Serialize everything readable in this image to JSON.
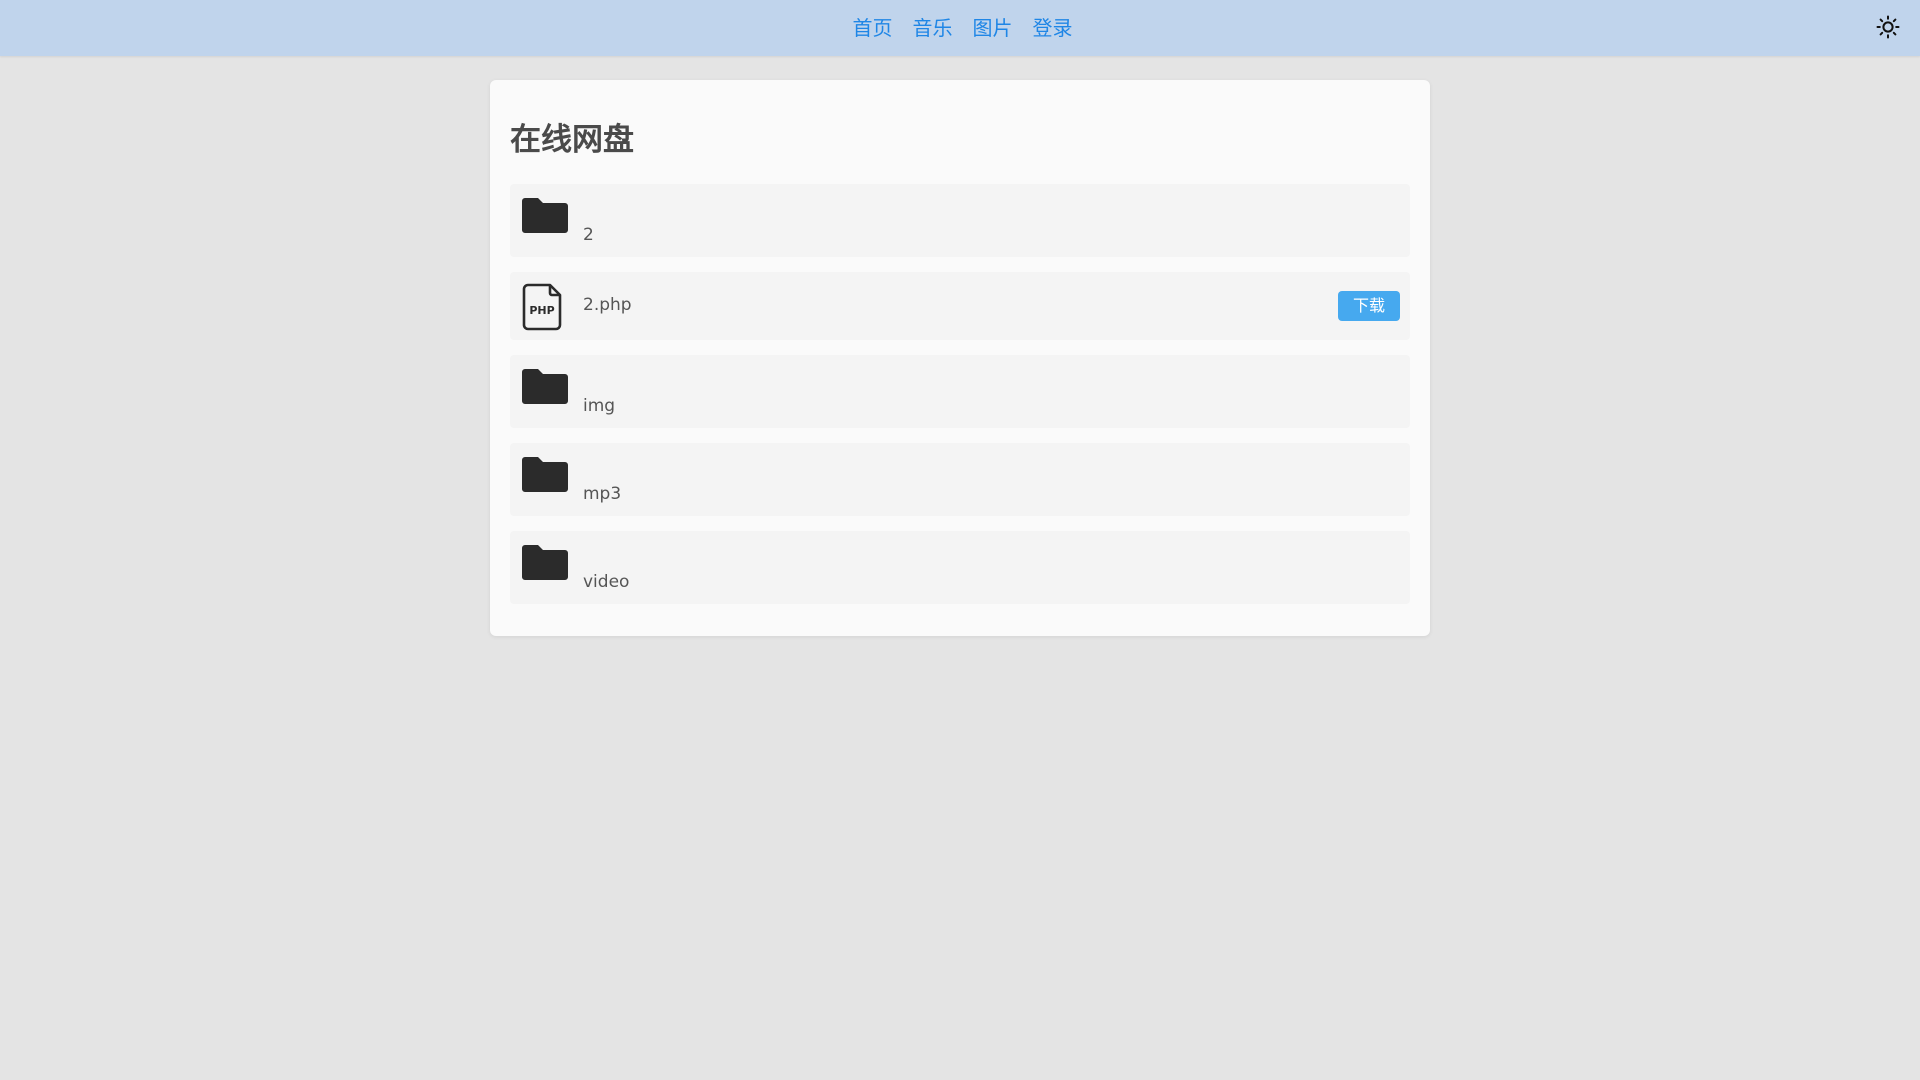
{
  "nav": {
    "items": [
      "首页",
      "音乐",
      "图片",
      "登录"
    ]
  },
  "theme_toggle": {
    "icon": "sun-icon"
  },
  "page": {
    "title": "在线网盘"
  },
  "files": [
    {
      "name": "2",
      "type": "folder",
      "icon": "folder-icon"
    },
    {
      "name": "2.php",
      "type": "file",
      "icon": "php-file-icon",
      "action": "下载"
    },
    {
      "name": "img",
      "type": "folder",
      "icon": "folder-icon"
    },
    {
      "name": "mp3",
      "type": "folder",
      "icon": "folder-icon"
    },
    {
      "name": "video",
      "type": "folder",
      "icon": "folder-icon"
    }
  ],
  "colors": {
    "topbar": "#c0d4ec",
    "nav_link": "#1f86e6",
    "download_button": "#46a9ef",
    "background": "#e4e4e4"
  }
}
